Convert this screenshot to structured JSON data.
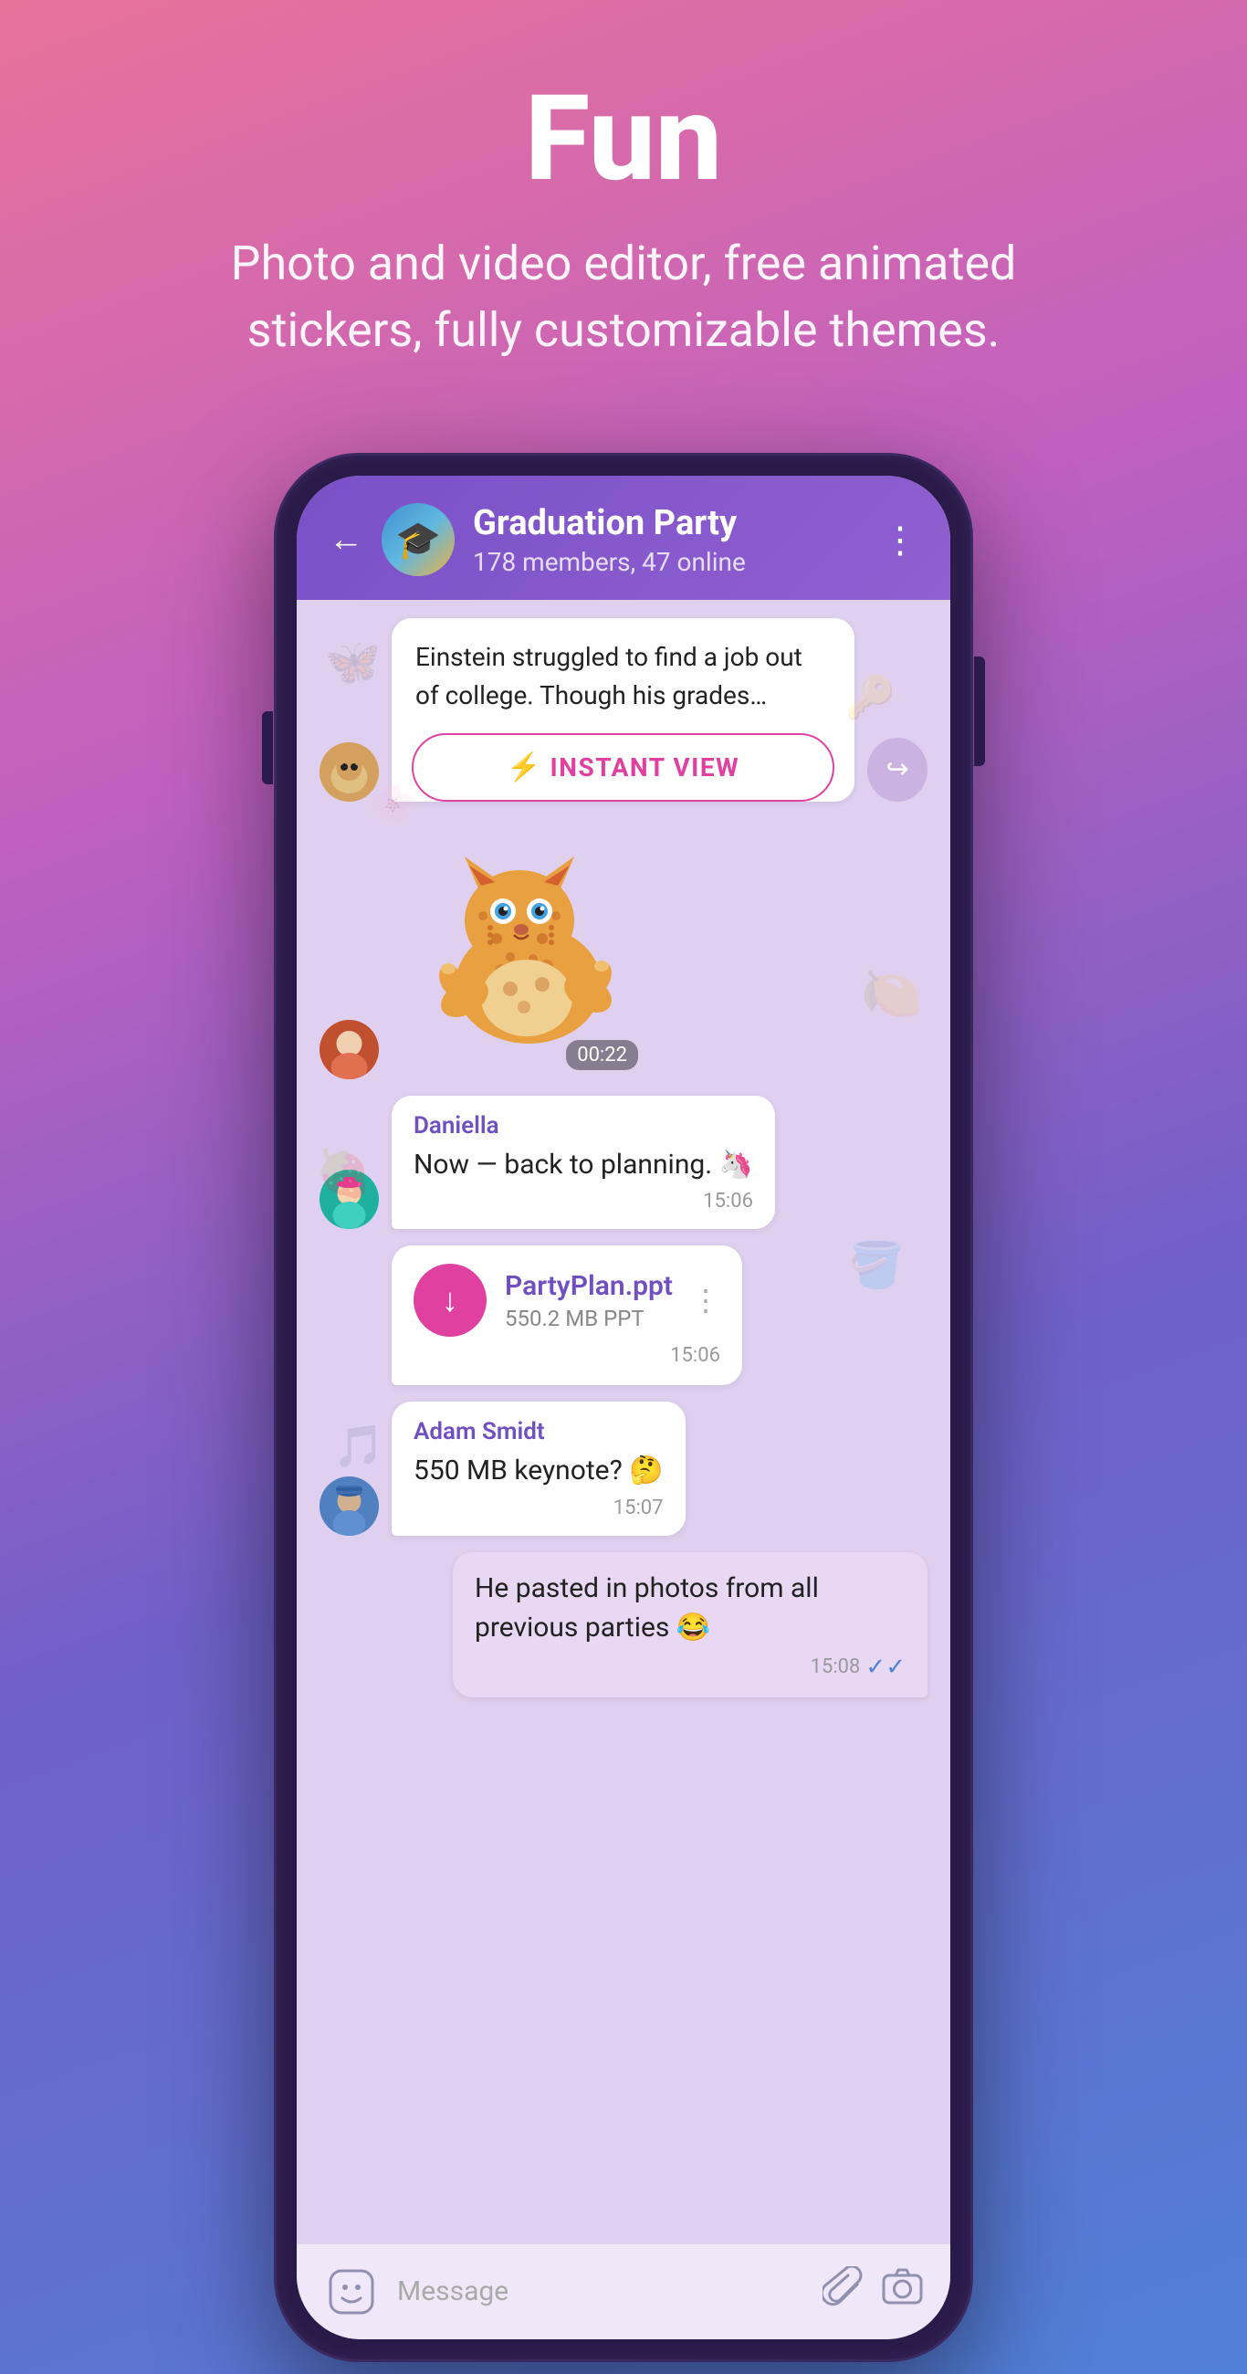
{
  "hero": {
    "title": "Fun",
    "subtitle": "Photo and video editor, free animated stickers, fully customizable themes."
  },
  "chat": {
    "name": "Graduation Party",
    "members": "178 members, 47 online",
    "back_label": "←",
    "menu_label": "⋮"
  },
  "messages": [
    {
      "id": "article",
      "type": "article",
      "avatar": "cat",
      "text": "Einstein struggled to find a job out of college. Though his grades…",
      "instant_view_label": "INSTANT VIEW"
    },
    {
      "id": "sticker",
      "type": "sticker",
      "avatar": "person1",
      "time": "00:22"
    },
    {
      "id": "daniella",
      "type": "text",
      "avatar": "person2",
      "sender": "Daniella",
      "text": "Now — back to planning. 🦄",
      "time": "15:06"
    },
    {
      "id": "file",
      "type": "file",
      "avatar": "person2",
      "file_name": "PartyPlan.ppt",
      "file_size": "550.2 MB PPT",
      "time": "15:06"
    },
    {
      "id": "adam",
      "type": "text",
      "avatar": "person3",
      "sender": "Adam Smidt",
      "text": "550 MB keynote? 🤔",
      "time": "15:07"
    },
    {
      "id": "own",
      "type": "text_right",
      "text": "He pasted in photos from all previous parties 😂",
      "time": "15:08",
      "ticks": "✓✓"
    }
  ],
  "bottom_bar": {
    "placeholder": "Message"
  }
}
